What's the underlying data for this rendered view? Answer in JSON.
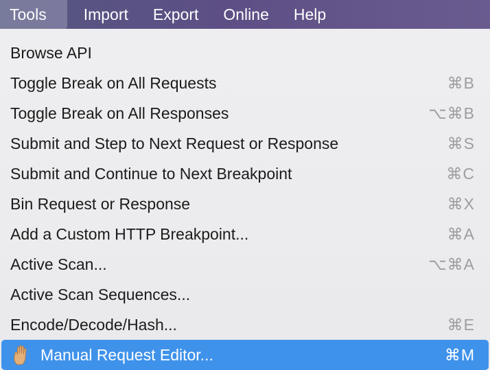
{
  "menubar": {
    "items": [
      {
        "label": "Tools"
      },
      {
        "label": "Import"
      },
      {
        "label": "Export"
      },
      {
        "label": "Online"
      },
      {
        "label": "Help"
      }
    ]
  },
  "tools_menu": {
    "items": [
      {
        "label": "Browse API",
        "shortcut": ""
      },
      {
        "label": "Toggle Break on All Requests",
        "shortcut": "⌘B"
      },
      {
        "label": "Toggle Break on All Responses",
        "shortcut": "⌥⌘B"
      },
      {
        "label": "Submit and Step to Next Request or Response",
        "shortcut": "⌘S"
      },
      {
        "label": "Submit and Continue to Next Breakpoint",
        "shortcut": "⌘C"
      },
      {
        "label": "Bin Request or Response",
        "shortcut": "⌘X"
      },
      {
        "label": "Add a Custom HTTP Breakpoint...",
        "shortcut": "⌘A"
      },
      {
        "label": "Active Scan...",
        "shortcut": "⌥⌘A"
      },
      {
        "label": "Active Scan Sequences...",
        "shortcut": ""
      },
      {
        "label": "Encode/Decode/Hash...",
        "shortcut": "⌘E"
      },
      {
        "label": "Manual Request Editor...",
        "shortcut": "⌘M",
        "icon": "hand-icon"
      }
    ]
  },
  "colors": {
    "highlight": "#3f92ea",
    "menubar_gradient_start": "#545681",
    "menubar_gradient_end": "#6a5b8f"
  }
}
